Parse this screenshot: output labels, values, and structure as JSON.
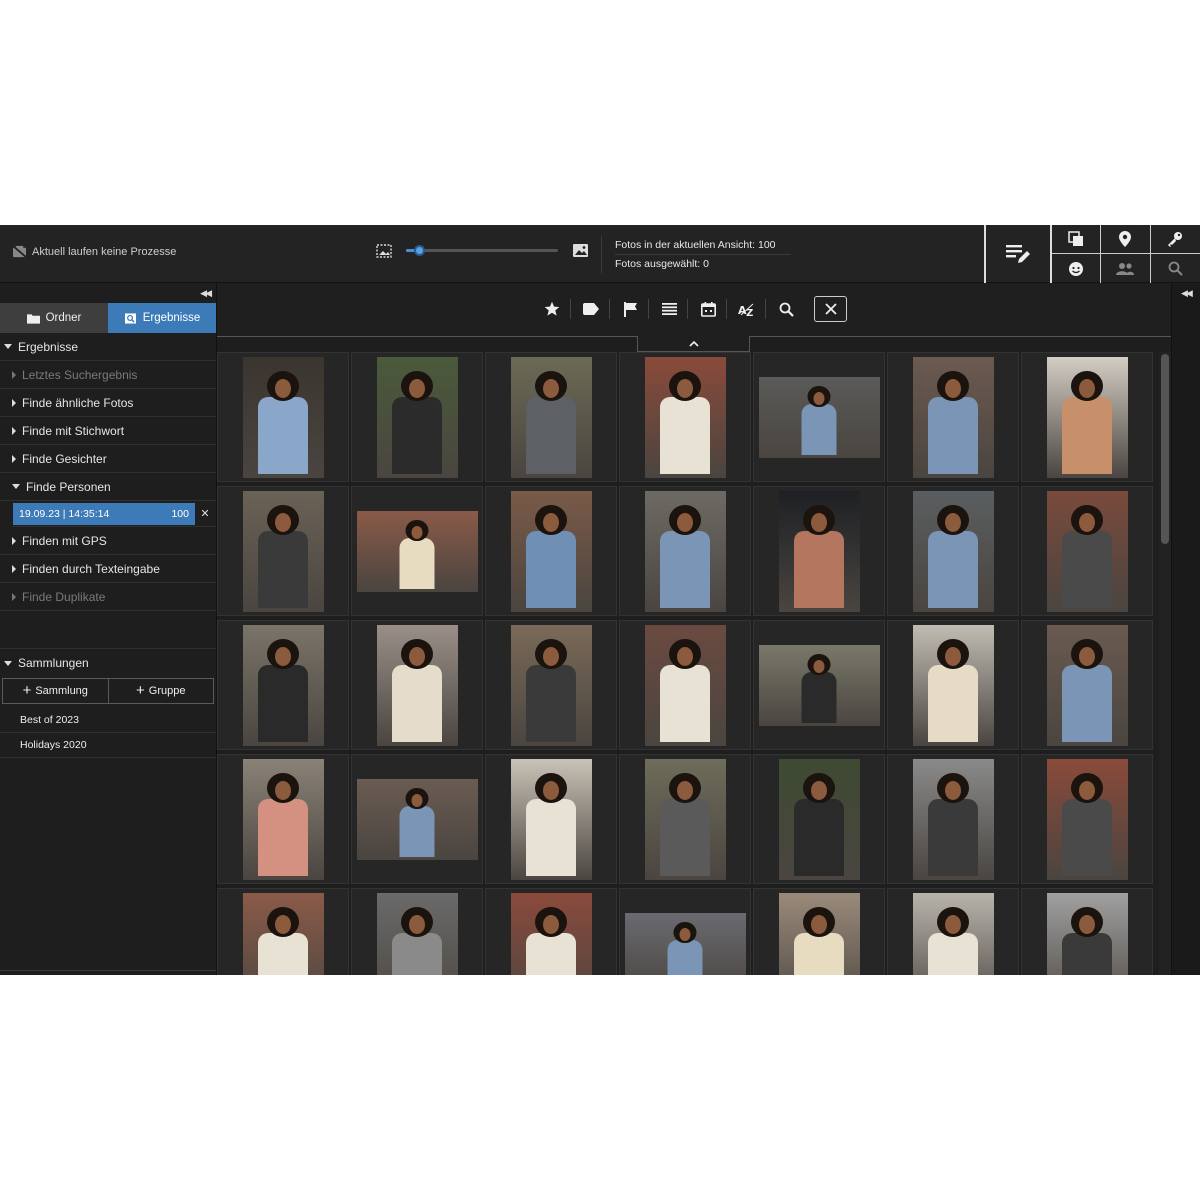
{
  "topbar": {
    "process_status": "Aktuell laufen keine Prozesse",
    "photos_in_view": "Fotos in der aktuellen Ansicht: 100",
    "photos_selected": "Fotos ausgewählt: 0",
    "zoom_level": 0.05
  },
  "sidebar": {
    "tabs": [
      {
        "label": "Ordner",
        "icon": "folder-icon",
        "active": false
      },
      {
        "label": "Ergebnisse",
        "icon": "search-results-icon",
        "active": true
      }
    ],
    "results_header": "Ergebnisse",
    "items": [
      {
        "label": "Letztes Suchergebnis",
        "disabled": true
      },
      {
        "label": "Finde ähnliche Fotos",
        "disabled": false
      },
      {
        "label": "Finde mit Stichwort",
        "disabled": false
      },
      {
        "label": "Finde Gesichter",
        "disabled": false
      },
      {
        "label": "Finde Personen",
        "disabled": false,
        "expanded": true
      },
      {
        "label": "Finden mit GPS",
        "disabled": false
      },
      {
        "label": "Finden durch Texteingabe",
        "disabled": false
      },
      {
        "label": "Finde Duplikate",
        "disabled": true
      }
    ],
    "selected_result": {
      "label": "19.09.23 | 14:35:14",
      "count": "100"
    },
    "collections_header": "Sammlungen",
    "add_collection": "Sammlung",
    "add_group": "Gruppe",
    "collections": [
      "Best of 2023",
      "Holidays 2020"
    ]
  },
  "filterbar": {
    "icons": [
      "star-icon",
      "tag-icon",
      "flag-icon",
      "list-icon",
      "calendar-icon",
      "sort-az-icon",
      "search-icon",
      "close-icon"
    ]
  },
  "colors": {
    "accent": "#3d7bb8",
    "background": "#1e1e1e",
    "panel": "#232323"
  },
  "photos": [
    {
      "o": "p",
      "bg": "#3b3530",
      "top": "#8aa6c8"
    },
    {
      "o": "p",
      "bg": "#4a5a3a",
      "top": "#2b2b2b"
    },
    {
      "o": "p",
      "bg": "#6b6a55",
      "top": "#5d6064"
    },
    {
      "o": "p",
      "bg": "#8a4a3a",
      "top": "#e8e2d4"
    },
    {
      "o": "l",
      "bg": "#5a5a58",
      "top": "#7a95b5"
    },
    {
      "o": "p",
      "bg": "#6b5a50",
      "top": "#7a95b5"
    },
    {
      "o": "p",
      "bg": "#d4cdc4",
      "top": "#c8906a"
    },
    {
      "o": "p",
      "bg": "#6b6256",
      "top": "#3a3a3a"
    },
    {
      "o": "l",
      "bg": "#8a5a48",
      "top": "#e8dcc0"
    },
    {
      "o": "p",
      "bg": "#7a5a48",
      "top": "#6f8fb5"
    },
    {
      "o": "p",
      "bg": "#6d6a64",
      "top": "#7a95b5"
    },
    {
      "o": "p",
      "bg": "#1e2024",
      "top": "#b4765e"
    },
    {
      "o": "p",
      "bg": "#5a5e60",
      "top": "#7a95b5"
    },
    {
      "o": "p",
      "bg": "#7a4a3c",
      "top": "#4a4a4a"
    },
    {
      "o": "p",
      "bg": "#7a7468",
      "top": "#2a2a2a"
    },
    {
      "o": "p",
      "bg": "#9a8f88",
      "top": "#e6dccb"
    },
    {
      "o": "p",
      "bg": "#7a6a58",
      "top": "#3a3a3a"
    },
    {
      "o": "p",
      "bg": "#6a4a40",
      "top": "#e8e2d4"
    },
    {
      "o": "l",
      "bg": "#7a786a",
      "top": "#2a2a2a"
    },
    {
      "o": "p",
      "bg": "#c0bcb2",
      "top": "#e6dcc6"
    },
    {
      "o": "p",
      "bg": "#6a5a50",
      "top": "#7a95b5"
    },
    {
      "o": "p",
      "bg": "#8a8276",
      "top": "#d49080"
    },
    {
      "o": "l",
      "bg": "#6a5c52",
      "top": "#7a95b5"
    },
    {
      "o": "p",
      "bg": "#c9c2b6",
      "top": "#e8e2d4"
    },
    {
      "o": "p",
      "bg": "#6e6c5a",
      "top": "#5a5a5a"
    },
    {
      "o": "p",
      "bg": "#3e4a32",
      "top": "#2a2a2a"
    },
    {
      "o": "p",
      "bg": "#8a8a8a",
      "top": "#3a3a3a"
    },
    {
      "o": "p",
      "bg": "#8a4a3a",
      "top": "#4a4a4a"
    },
    {
      "o": "p",
      "bg": "#8a5a48",
      "top": "#e8e2d4"
    },
    {
      "o": "p",
      "bg": "#6a6a6a",
      "top": "#8a8a8a"
    },
    {
      "o": "p",
      "bg": "#8a4a3c",
      "top": "#e8e2d4"
    },
    {
      "o": "l",
      "bg": "#6a6a70",
      "top": "#7a95b5"
    },
    {
      "o": "p",
      "bg": "#9a8a7a",
      "top": "#e8dcc0"
    },
    {
      "o": "p",
      "bg": "#b8b4ac",
      "top": "#e8e2d4"
    },
    {
      "o": "p",
      "bg": "#a0a0a0",
      "top": "#3a3a3a"
    }
  ]
}
